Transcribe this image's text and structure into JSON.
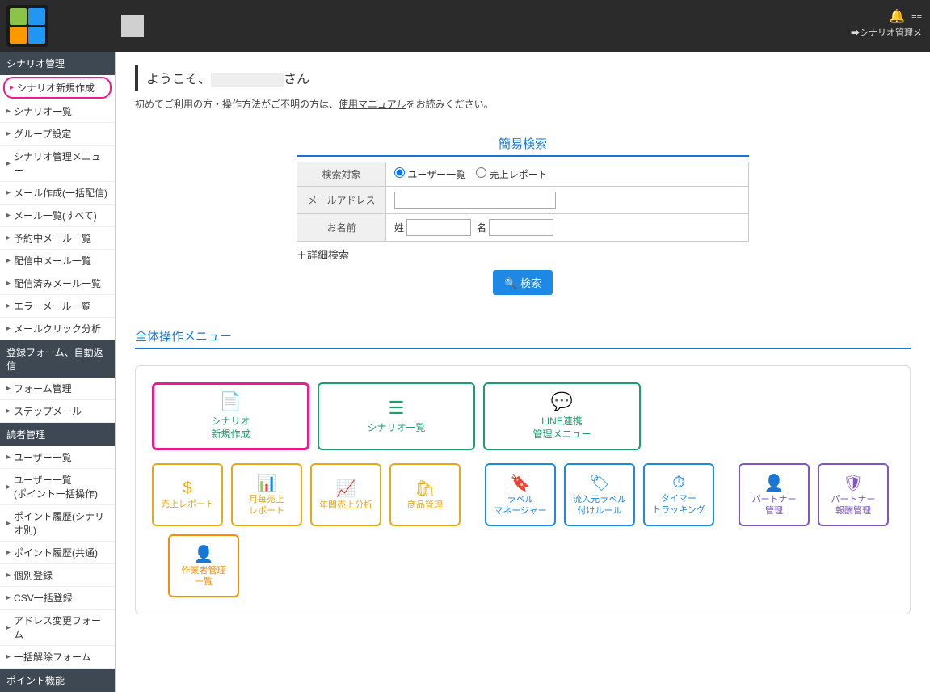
{
  "topbar": {
    "breadcrumb": "シナリオ管理メ"
  },
  "sidebar": {
    "sections": [
      {
        "header": "シナリオ管理",
        "items": [
          {
            "label": "シナリオ新規作成",
            "highlight": true
          },
          {
            "label": "シナリオ一覧"
          },
          {
            "label": "グループ設定"
          },
          {
            "label": "シナリオ管理メニュー"
          },
          {
            "label": "メール作成(一括配信)"
          },
          {
            "label": "メール一覧(すべて)"
          },
          {
            "label": "予約中メール一覧"
          },
          {
            "label": "配信中メール一覧"
          },
          {
            "label": "配信済みメール一覧"
          },
          {
            "label": "エラーメール一覧"
          },
          {
            "label": "メールクリック分析"
          }
        ]
      },
      {
        "header": "登録フォーム、自動返信",
        "items": [
          {
            "label": "フォーム管理"
          },
          {
            "label": "ステップメール"
          }
        ]
      },
      {
        "header": "読者管理",
        "items": [
          {
            "label": "ユーザー一覧"
          },
          {
            "label": "ユーザー一覧\n(ポイント一括操作)"
          },
          {
            "label": "ポイント履歴(シナリオ別)"
          },
          {
            "label": "ポイント履歴(共通)"
          },
          {
            "label": "個別登録"
          },
          {
            "label": "CSV一括登録"
          },
          {
            "label": "アドレス変更フォーム"
          },
          {
            "label": "一括解除フォーム"
          }
        ]
      },
      {
        "header": "ポイント機能",
        "items": []
      }
    ]
  },
  "welcome": {
    "prefix": "ようこそ、",
    "suffix": "さん"
  },
  "intro": {
    "text_before": "初めてご利用の方・操作方法がご不明の方は、",
    "link": "使用マニュアル",
    "text_after": "をお読みください。"
  },
  "quicksearch": {
    "title": "簡易検索",
    "rows": {
      "target_label": "検索対象",
      "radio1": "ユーザー一覧",
      "radio2": "売上レポート",
      "email_label": "メールアドレス",
      "name_label": "お名前",
      "surname": "姓",
      "firstname": "名"
    },
    "detail": "＋詳細検索",
    "button": "検索"
  },
  "menu": {
    "title": "全体操作メニュー",
    "big": [
      {
        "line1": "シナリオ",
        "line2": "新規作成",
        "highlight": true,
        "icon": "file-plus"
      },
      {
        "line1": "シナリオ一覧",
        "line2": "",
        "icon": "list"
      },
      {
        "line1": "LINE連携",
        "line2": "管理メニュー",
        "icon": "chat"
      }
    ],
    "small": [
      {
        "label": "売上レポート",
        "color": "c-yellow",
        "icon": "$"
      },
      {
        "label": "月毎売上\nレポート",
        "color": "c-yellow",
        "icon": "bar"
      },
      {
        "label": "年間売上分析",
        "color": "c-yellow",
        "icon": "chart"
      },
      {
        "label": "商品管理",
        "color": "c-yellow",
        "icon": "cart",
        "gap_after": true
      },
      {
        "label": "ラベル\nマネージャー",
        "color": "c-blue",
        "icon": "bookmark"
      },
      {
        "label": "流入元ラベル\n付けルール",
        "color": "c-blue",
        "icon": "tag"
      },
      {
        "label": "タイマー\nトラッキング",
        "color": "c-blue",
        "icon": "clock",
        "gap_after": true
      },
      {
        "label": "パートナー\n管理",
        "color": "c-purple",
        "icon": "user-gear"
      },
      {
        "label": "パートナー\n報酬管理",
        "color": "c-purple",
        "icon": "shield",
        "gap_after": true
      },
      {
        "label": "作業者管理\n一覧",
        "color": "c-orange",
        "icon": "user"
      }
    ]
  }
}
